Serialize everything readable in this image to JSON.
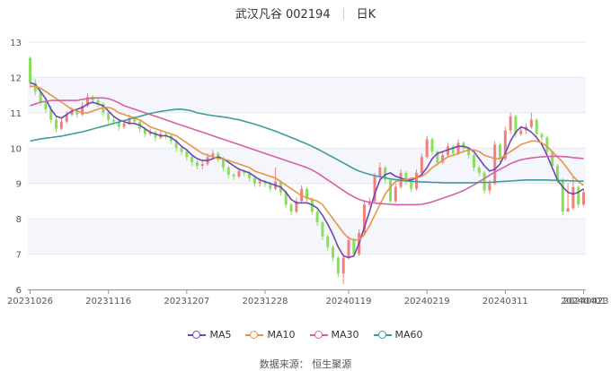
{
  "title": {
    "stock": "武汉凡谷 002194",
    "period": "日K"
  },
  "source": "数据来源：  恒生聚源",
  "chart_data": {
    "type": "candlestick",
    "y_ticks": [
      "6",
      "7",
      "8",
      "9",
      "10",
      "11",
      "12",
      "13"
    ],
    "ylim": [
      6,
      13
    ],
    "x_ticks": [
      {
        "label": "20231026",
        "index": 0
      },
      {
        "label": "20231116",
        "index": 15
      },
      {
        "label": "20231207",
        "index": 30
      },
      {
        "label": "20231228",
        "index": 45
      },
      {
        "label": "20240119",
        "index": 61
      },
      {
        "label": "20240219",
        "index": 76
      },
      {
        "label": "20240311",
        "index": 91
      },
      {
        "label": "20240401",
        "index": 106
      },
      {
        "label": "20240423",
        "index": 119
      }
    ],
    "up_color": "#f07f7f",
    "down_color": "#88e05a",
    "candles": [
      [
        12.55,
        11.85,
        12.6,
        11.7
      ],
      [
        11.85,
        11.6,
        11.95,
        11.5
      ],
      [
        11.6,
        11.3,
        11.7,
        11.2
      ],
      [
        11.3,
        11.1,
        11.4,
        11.0
      ],
      [
        11.1,
        10.8,
        11.2,
        10.7
      ],
      [
        10.8,
        10.55,
        10.9,
        10.45
      ],
      [
        10.55,
        10.75,
        10.85,
        10.5
      ],
      [
        10.75,
        10.95,
        11.05,
        10.7
      ],
      [
        10.95,
        11.05,
        11.15,
        10.9
      ],
      [
        11.05,
        10.95,
        11.1,
        10.85
      ],
      [
        10.95,
        11.2,
        11.3,
        10.9
      ],
      [
        11.2,
        11.45,
        11.55,
        11.15
      ],
      [
        11.45,
        11.35,
        11.5,
        11.25
      ],
      [
        11.35,
        11.25,
        11.4,
        11.15
      ],
      [
        11.25,
        11.0,
        11.3,
        10.9
      ],
      [
        11.0,
        10.8,
        11.05,
        10.7
      ],
      [
        10.8,
        10.75,
        10.9,
        10.65
      ],
      [
        10.75,
        10.6,
        10.8,
        10.5
      ],
      [
        10.6,
        10.7,
        10.8,
        10.55
      ],
      [
        10.7,
        10.85,
        10.95,
        10.65
      ],
      [
        10.85,
        10.75,
        10.9,
        10.65
      ],
      [
        10.75,
        10.55,
        10.8,
        10.45
      ],
      [
        10.55,
        10.4,
        10.6,
        10.3
      ],
      [
        10.4,
        10.45,
        10.55,
        10.35
      ],
      [
        10.45,
        10.3,
        10.5,
        10.2
      ],
      [
        10.3,
        10.4,
        10.5,
        10.25
      ],
      [
        10.4,
        10.35,
        10.45,
        10.25
      ],
      [
        10.35,
        10.2,
        10.4,
        10.1
      ],
      [
        10.2,
        10.0,
        10.25,
        9.9
      ],
      [
        10.0,
        9.9,
        10.05,
        9.8
      ],
      [
        9.9,
        9.75,
        9.95,
        9.65
      ],
      [
        9.75,
        9.6,
        9.8,
        9.5
      ],
      [
        9.6,
        9.5,
        9.65,
        9.4
      ],
      [
        9.5,
        9.55,
        9.65,
        9.4
      ],
      [
        9.55,
        9.75,
        9.85,
        9.5
      ],
      [
        9.75,
        9.85,
        9.95,
        9.7
      ],
      [
        9.85,
        9.7,
        9.9,
        9.6
      ],
      [
        9.7,
        9.45,
        9.75,
        9.35
      ],
      [
        9.45,
        9.25,
        9.5,
        9.15
      ],
      [
        9.25,
        9.2,
        9.3,
        9.1
      ],
      [
        9.2,
        9.35,
        9.45,
        9.15
      ],
      [
        9.35,
        9.3,
        9.4,
        9.2
      ],
      [
        9.3,
        9.15,
        9.35,
        9.05
      ],
      [
        9.15,
        9.0,
        9.2,
        8.9
      ],
      [
        9.0,
        9.05,
        9.15,
        8.9
      ],
      [
        9.05,
        9.0,
        9.1,
        8.9
      ],
      [
        9.0,
        8.85,
        9.05,
        8.75
      ],
      [
        8.85,
        9.05,
        9.45,
        8.8
      ],
      [
        9.05,
        8.75,
        9.1,
        8.65
      ],
      [
        8.75,
        8.4,
        8.8,
        8.3
      ],
      [
        8.4,
        8.2,
        8.45,
        8.1
      ],
      [
        8.2,
        8.5,
        8.6,
        8.15
      ],
      [
        8.5,
        8.85,
        8.95,
        8.45
      ],
      [
        8.85,
        8.55,
        8.9,
        8.45
      ],
      [
        8.55,
        8.2,
        8.6,
        8.1
      ],
      [
        8.2,
        7.9,
        8.25,
        7.8
      ],
      [
        7.9,
        7.5,
        7.95,
        7.4
      ],
      [
        7.5,
        7.2,
        7.55,
        7.1
      ],
      [
        7.2,
        6.9,
        7.25,
        6.8
      ],
      [
        6.9,
        6.45,
        6.95,
        6.35
      ],
      [
        6.45,
        6.9,
        7.0,
        6.15
      ],
      [
        6.9,
        7.4,
        7.5,
        6.85
      ],
      [
        7.4,
        7.0,
        7.45,
        6.9
      ],
      [
        7.0,
        7.6,
        7.7,
        6.95
      ],
      [
        7.6,
        8.4,
        8.5,
        7.55
      ],
      [
        8.4,
        8.5,
        8.6,
        8.35
      ],
      [
        8.5,
        9.2,
        9.3,
        8.45
      ],
      [
        9.2,
        9.45,
        9.6,
        9.1
      ],
      [
        9.45,
        9.1,
        9.5,
        9.0
      ],
      [
        9.1,
        8.5,
        9.15,
        8.45
      ],
      [
        8.5,
        8.9,
        9.0,
        8.45
      ],
      [
        8.9,
        9.3,
        9.4,
        8.85
      ],
      [
        9.3,
        9.05,
        9.35,
        8.95
      ],
      [
        9.05,
        8.85,
        9.1,
        8.75
      ],
      [
        8.85,
        9.3,
        9.4,
        8.8
      ],
      [
        9.3,
        9.75,
        9.85,
        9.25
      ],
      [
        9.75,
        10.25,
        10.35,
        9.7
      ],
      [
        10.25,
        9.9,
        10.3,
        9.8
      ],
      [
        9.9,
        9.6,
        9.95,
        9.5
      ],
      [
        9.6,
        9.8,
        9.9,
        9.55
      ],
      [
        9.8,
        10.05,
        10.15,
        9.75
      ],
      [
        10.05,
        9.85,
        10.1,
        9.75
      ],
      [
        9.85,
        10.15,
        10.25,
        9.8
      ],
      [
        10.15,
        10.0,
        10.2,
        9.9
      ],
      [
        10.0,
        9.8,
        10.05,
        9.7
      ],
      [
        9.8,
        9.45,
        9.85,
        9.35
      ],
      [
        9.45,
        9.3,
        9.5,
        9.2
      ],
      [
        9.3,
        8.8,
        9.35,
        8.7
      ],
      [
        8.8,
        9.0,
        9.1,
        8.7
      ],
      [
        9.0,
        10.1,
        10.2,
        8.95
      ],
      [
        10.1,
        9.7,
        10.15,
        9.6
      ],
      [
        9.7,
        10.5,
        10.6,
        9.65
      ],
      [
        10.5,
        10.9,
        11.0,
        10.4
      ],
      [
        10.9,
        10.4,
        10.95,
        10.3
      ],
      [
        10.4,
        10.5,
        10.6,
        10.35
      ],
      [
        10.5,
        10.6,
        10.7,
        10.4
      ],
      [
        10.6,
        10.8,
        11.0,
        10.55
      ],
      [
        10.8,
        10.4,
        10.85,
        10.3
      ],
      [
        10.4,
        10.3,
        10.45,
        10.2
      ],
      [
        10.3,
        9.9,
        10.35,
        9.8
      ],
      [
        9.9,
        9.5,
        9.95,
        9.4
      ],
      [
        9.5,
        9.1,
        9.55,
        9.0
      ],
      [
        9.1,
        8.2,
        9.15,
        8.1
      ],
      [
        8.2,
        8.3,
        9.0,
        8.2
      ],
      [
        8.3,
        8.9,
        9.2,
        8.25
      ],
      [
        8.9,
        8.4,
        8.95,
        8.3
      ],
      [
        8.4,
        8.75,
        8.85,
        8.35
      ]
    ],
    "ma_series": [
      {
        "name": "MA5",
        "color": "#6c46b8",
        "values": [
          11.85,
          11.8,
          11.6,
          11.4,
          11.1,
          10.9,
          10.85,
          10.95,
          11.05,
          11.1,
          11.15,
          11.25,
          11.3,
          11.25,
          11.2,
          11.05,
          10.9,
          10.8,
          10.75,
          10.7,
          10.7,
          10.65,
          10.55,
          10.45,
          10.4,
          10.35,
          10.35,
          10.3,
          10.2,
          10.05,
          9.95,
          9.8,
          9.7,
          9.65,
          9.65,
          9.7,
          9.75,
          9.7,
          9.6,
          9.5,
          9.4,
          9.35,
          9.3,
          9.2,
          9.1,
          9.05,
          9.0,
          8.95,
          8.9,
          8.75,
          8.55,
          8.45,
          8.45,
          8.45,
          8.4,
          8.3,
          8.1,
          7.85,
          7.55,
          7.2,
          6.95,
          6.9,
          6.95,
          7.3,
          7.75,
          8.2,
          8.7,
          9.1,
          9.25,
          9.3,
          9.2,
          9.15,
          9.1,
          9.1,
          9.15,
          9.25,
          9.45,
          9.7,
          9.85,
          9.9,
          9.95,
          10.0,
          10.05,
          10.05,
          10.0,
          9.9,
          9.7,
          9.5,
          9.35,
          9.4,
          9.55,
          9.85,
          10.2,
          10.45,
          10.6,
          10.55,
          10.45,
          10.3,
          10.1,
          9.8,
          9.45,
          9.1,
          8.9,
          8.75,
          8.7,
          8.75,
          8.85
        ]
      },
      {
        "name": "MA10",
        "color": "#e8934a",
        "values": [
          11.75,
          11.75,
          11.7,
          11.6,
          11.5,
          11.4,
          11.3,
          11.2,
          11.1,
          11.05,
          11.0,
          11.0,
          11.05,
          11.1,
          11.15,
          11.15,
          11.1,
          11.0,
          10.95,
          10.9,
          10.85,
          10.8,
          10.7,
          10.6,
          10.55,
          10.5,
          10.45,
          10.4,
          10.35,
          10.25,
          10.15,
          10.05,
          9.95,
          9.85,
          9.8,
          9.75,
          9.7,
          9.7,
          9.65,
          9.6,
          9.55,
          9.5,
          9.45,
          9.35,
          9.3,
          9.25,
          9.2,
          9.15,
          9.05,
          8.95,
          8.85,
          8.75,
          8.65,
          8.6,
          8.55,
          8.5,
          8.4,
          8.2,
          8.0,
          7.8,
          7.6,
          7.45,
          7.4,
          7.4,
          7.55,
          7.8,
          8.1,
          8.4,
          8.7,
          8.9,
          9.05,
          9.1,
          9.1,
          9.15,
          9.15,
          9.2,
          9.3,
          9.45,
          9.55,
          9.65,
          9.75,
          9.8,
          9.85,
          9.9,
          9.95,
          9.95,
          9.9,
          9.8,
          9.75,
          9.7,
          9.7,
          9.8,
          9.9,
          10.0,
          10.1,
          10.15,
          10.2,
          10.2,
          10.15,
          10.05,
          9.9,
          9.75,
          9.6,
          9.4,
          9.2,
          9.05,
          8.95
        ]
      },
      {
        "name": "MA30",
        "color": "#d75fa6",
        "values": [
          11.2,
          11.25,
          11.3,
          11.32,
          11.35,
          11.35,
          11.35,
          11.35,
          11.35,
          11.35,
          11.38,
          11.4,
          11.42,
          11.42,
          11.42,
          11.4,
          11.35,
          11.28,
          11.2,
          11.15,
          11.1,
          11.05,
          11.0,
          10.95,
          10.9,
          10.85,
          10.8,
          10.75,
          10.7,
          10.65,
          10.6,
          10.55,
          10.5,
          10.45,
          10.4,
          10.35,
          10.3,
          10.25,
          10.2,
          10.15,
          10.1,
          10.05,
          10.0,
          9.95,
          9.9,
          9.85,
          9.8,
          9.75,
          9.7,
          9.65,
          9.6,
          9.55,
          9.5,
          9.45,
          9.38,
          9.3,
          9.2,
          9.1,
          9.0,
          8.9,
          8.8,
          8.7,
          8.62,
          8.55,
          8.5,
          8.47,
          8.45,
          8.43,
          8.42,
          8.41,
          8.4,
          8.4,
          8.4,
          8.4,
          8.4,
          8.41,
          8.44,
          8.48,
          8.53,
          8.58,
          8.63,
          8.68,
          8.74,
          8.8,
          8.88,
          8.96,
          9.05,
          9.14,
          9.23,
          9.32,
          9.4,
          9.48,
          9.56,
          9.62,
          9.67,
          9.7,
          9.72,
          9.74,
          9.75,
          9.76,
          9.77,
          9.77,
          9.76,
          9.75,
          9.73,
          9.72,
          9.7
        ]
      },
      {
        "name": "MA60",
        "color": "#3f9c9c",
        "values": [
          10.2,
          10.23,
          10.26,
          10.28,
          10.3,
          10.32,
          10.34,
          10.37,
          10.4,
          10.43,
          10.46,
          10.5,
          10.54,
          10.58,
          10.62,
          10.66,
          10.7,
          10.74,
          10.78,
          10.82,
          10.86,
          10.9,
          10.94,
          10.98,
          11.01,
          11.04,
          11.06,
          11.08,
          11.1,
          11.1,
          11.08,
          11.05,
          11.0,
          10.97,
          10.94,
          10.92,
          10.9,
          10.88,
          10.86,
          10.83,
          10.8,
          10.76,
          10.72,
          10.68,
          10.63,
          10.58,
          10.53,
          10.48,
          10.42,
          10.36,
          10.3,
          10.24,
          10.18,
          10.12,
          10.05,
          9.98,
          9.9,
          9.82,
          9.74,
          9.66,
          9.58,
          9.5,
          9.42,
          9.35,
          9.3,
          9.26,
          9.22,
          9.19,
          9.16,
          9.13,
          9.11,
          9.09,
          9.07,
          9.06,
          9.05,
          9.04,
          9.04,
          9.03,
          9.03,
          9.02,
          9.02,
          9.02,
          9.02,
          9.02,
          9.02,
          9.02,
          9.03,
          9.03,
          9.03,
          9.04,
          9.05,
          9.06,
          9.07,
          9.08,
          9.09,
          9.1,
          9.1,
          9.1,
          9.1,
          9.1,
          9.09,
          9.09,
          9.08,
          9.08,
          9.07,
          9.07,
          9.06
        ]
      }
    ]
  }
}
